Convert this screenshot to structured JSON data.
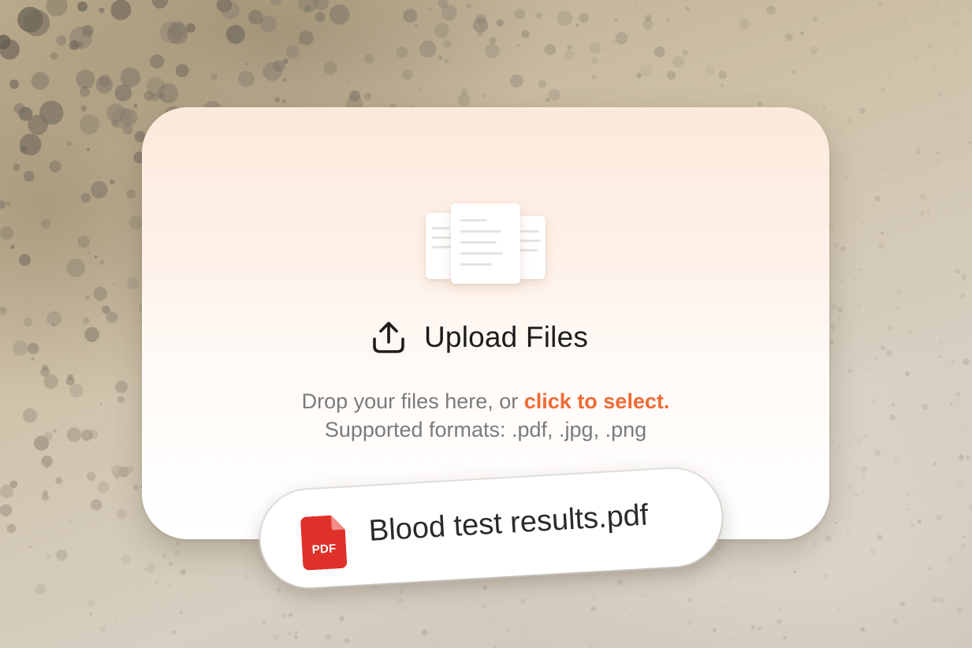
{
  "dropzone": {
    "title": "Upload Files",
    "hint_prefix": "Drop your files here, or ",
    "hint_link": "click to select.",
    "formats": "Supported formats: .pdf, .jpg, .png"
  },
  "file_chip": {
    "badge": "PDF",
    "name": "Blood test results.pdf"
  },
  "icons": {
    "illustration": "documents-illustration",
    "upload": "upload-icon",
    "file": "pdf-file-icon"
  },
  "colors": {
    "accent": "#f06a35",
    "pdf_red": "#e0302a",
    "title": "#1c1c1c",
    "hint": "#7b7b7b"
  }
}
